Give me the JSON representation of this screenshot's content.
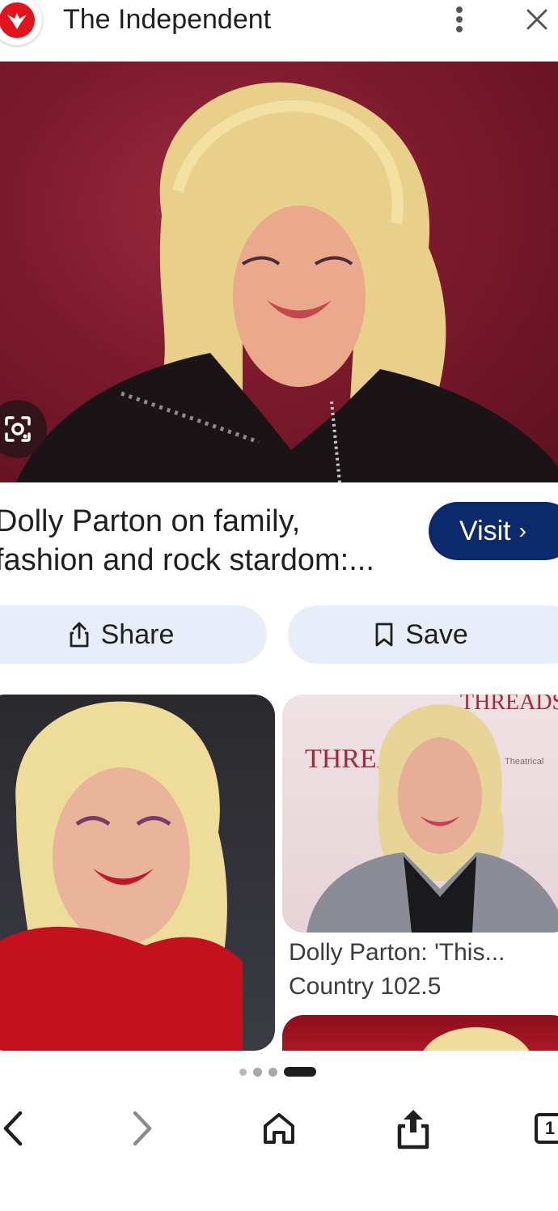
{
  "header": {
    "site_name": "The Independent",
    "logo_icon": "independent-eagle-icon",
    "more_icon": "more-vert-icon",
    "close_icon": "close-icon"
  },
  "hero": {
    "lens_icon": "google-lens-icon",
    "background_color": "#7c1a2d"
  },
  "result": {
    "title_line1": "Dolly Parton on family,",
    "title_line2": "fashion and rock stardom:...",
    "visit_label": "Visit",
    "visit_icon": "chevron-right-icon"
  },
  "actions": {
    "share_label": "Share",
    "share_icon": "share-icon",
    "save_label": "Save",
    "save_icon": "bookmark-icon"
  },
  "related": {
    "right_card": {
      "title": "Dolly Parton: 'This...",
      "source": "Country 102.5",
      "sign_text_1": "THREADS",
      "sign_text_2": "THREAD",
      "sign_text_3": "Theatrical"
    }
  },
  "pagination": {
    "count": 4,
    "active_index": 3
  },
  "bottom_nav": {
    "back_icon": "arrow-back-icon",
    "forward_icon": "arrow-forward-icon",
    "home_icon": "home-icon",
    "share_icon": "share-upload-icon",
    "tabs_count": "1"
  },
  "colors": {
    "accent_visit": "#0b2a6b",
    "pill_bg": "#e8eef9",
    "logo_red": "#e1141c"
  }
}
